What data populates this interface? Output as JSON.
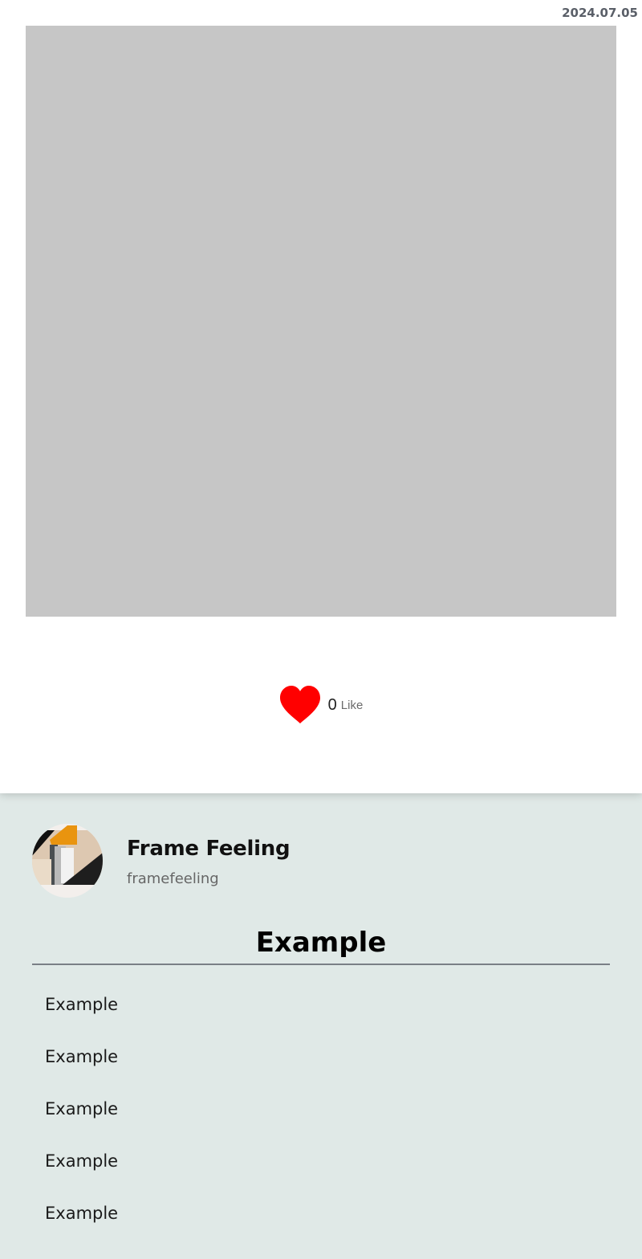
{
  "post": {
    "date": "2024.07.05",
    "likes": {
      "count": "0",
      "label": "Like"
    }
  },
  "colors": {
    "heart": "#ff0000",
    "photo_placeholder": "#c6c6c6",
    "page_background": "#e0e9e7"
  },
  "profile": {
    "name": "Frame Feeling",
    "handle": "framefeeling",
    "avatar_icon": "frame-feeling-logo"
  },
  "section": {
    "title": "Example",
    "items": [
      "Example",
      "Example",
      "Example",
      "Example",
      "Example"
    ]
  }
}
